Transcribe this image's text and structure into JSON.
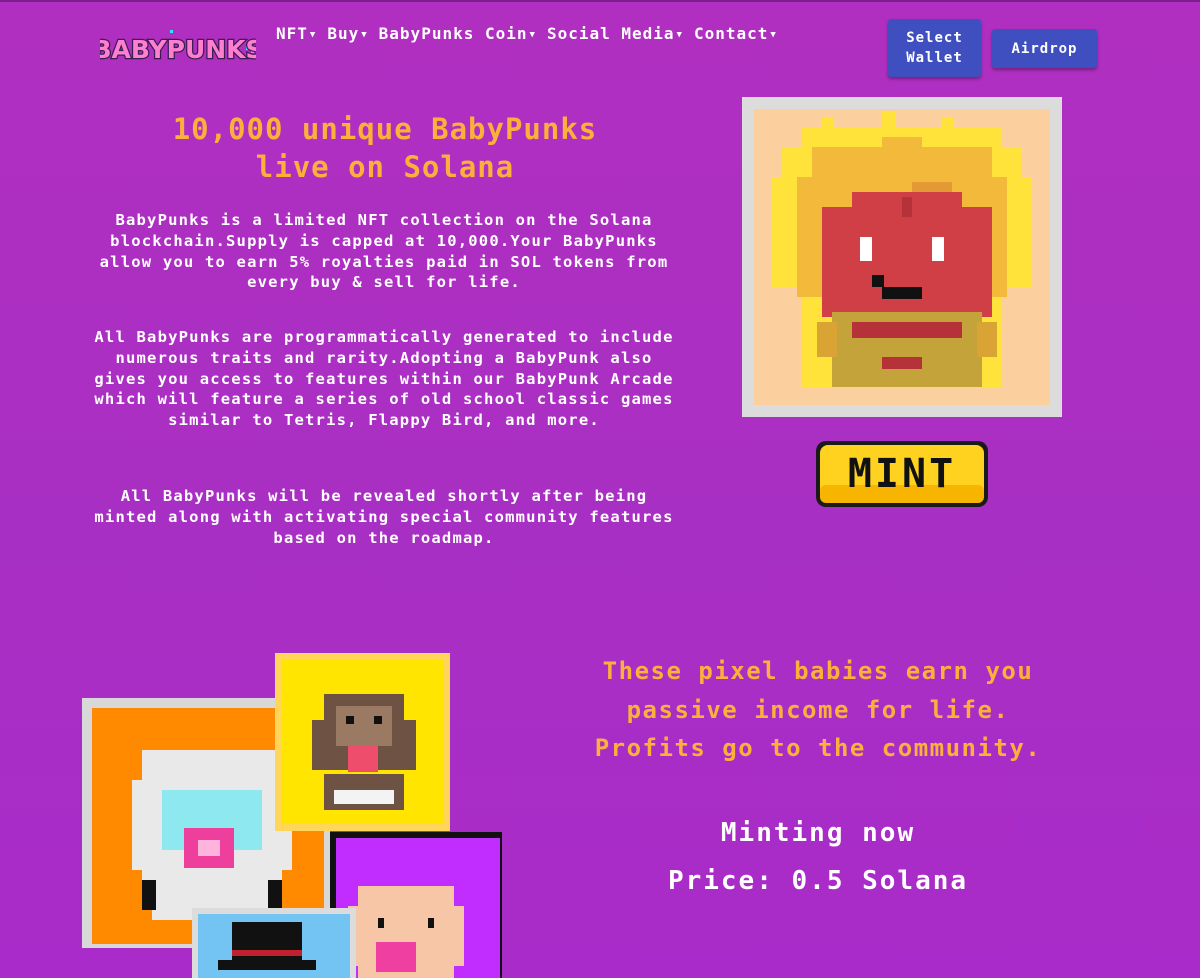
{
  "brand": {
    "logo_text": "BABYPUNKS"
  },
  "nav": {
    "items": [
      {
        "label": "NFT"
      },
      {
        "label": "Buy"
      },
      {
        "label": "BabyPunks Coin"
      },
      {
        "label": "Social Media"
      },
      {
        "label": "Contact"
      }
    ],
    "caret_icon": "chevron-down-icon"
  },
  "buttons": {
    "wallet_line1": "Select",
    "wallet_line2": "Wallet",
    "airdrop": "Airdrop",
    "mint": "MINT"
  },
  "hero": {
    "title_line1": "10,000 unique BabyPunks",
    "title_line2": "live on Solana",
    "paragraphs": [
      "BabyPunks is a limited NFT collection on the Solana blockchain.Supply is capped at 10,000.Your BabyPunks allow you to earn 5% royalties paid in SOL tokens from every buy & sell for life.",
      "All BabyPunks are programmatically generated to include numerous traits and rarity.Adopting a BabyPunk also gives you access to features within our BabyPunk Arcade which will feature a series of old school classic games similar to Tetris, Flappy Bird, and more.",
      "All BabyPunks will be revealed shortly after being minted along with activating special community features based on the roadmap."
    ]
  },
  "section2": {
    "tagline_line1": "These pixel babies earn you",
    "tagline_line2": "passive income for life.",
    "tagline_line3": "Profits go to the community.",
    "minting": "Minting now",
    "price": "Price: 0.5 Solana"
  },
  "colors": {
    "background": "#ad2fc4",
    "accent_gold": "#fbb03b",
    "button_blue": "#3f4fbf",
    "mint_yellow": "#ffd21f"
  }
}
